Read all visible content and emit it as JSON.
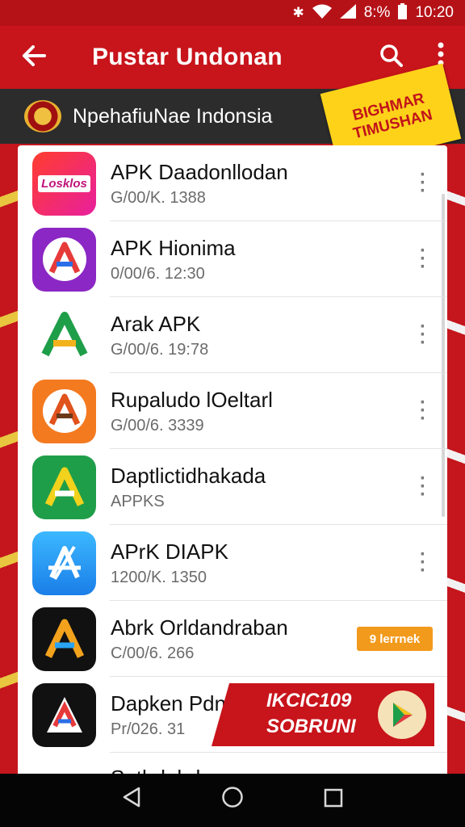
{
  "status": {
    "battery": "8:%",
    "time": "10:20"
  },
  "appbar": {
    "title": "Pustar Undonan"
  },
  "strip": {
    "text": "NpehafiuNae  Indonsia",
    "ribbon_line1": "BIGHMAR",
    "ribbon_line2": "TIMUSHAN"
  },
  "apps": [
    {
      "name": "APK Daadonllodan",
      "sub": "G/00/K. 1388",
      "icon": "lookos-icon",
      "icon_text": "Losklos",
      "color": "#e81f6a"
    },
    {
      "name": "APK Hionima",
      "sub": "0/00/6. 12:30",
      "icon": "a-logo-purple-icon",
      "color": "#8b27c4"
    },
    {
      "name": "Arak APK",
      "sub": "G/00/6. 19:78",
      "icon": "a-logo-green-icon",
      "color": "#ffffff"
    },
    {
      "name": "Rupaludo lOeltarl",
      "sub": "G/00/6. 3339",
      "icon": "a-logo-orange-icon",
      "color": "#f47a20"
    },
    {
      "name": "Daptlictidhakada",
      "sub": "APPKS",
      "icon": "a-logo-green-square-icon",
      "color": "#1f9e49"
    },
    {
      "name": "APrK DIAPK",
      "sub": "1200/K. 1350",
      "icon": "app-store-a-icon",
      "color": "#2aa3f2"
    },
    {
      "name": "Abrk Orldandraban",
      "sub": "C/00/6. 266",
      "icon": "a-logo-black-icon",
      "color": "#111111",
      "tag": "9 lerrnek"
    },
    {
      "name": "Dapken Pdn",
      "sub": "Pr/026. 31",
      "icon": "a-logo-black2-icon",
      "color": "#111111"
    },
    {
      "name": "Sathdahd",
      "sub": "",
      "icon": "partial-icon",
      "color": "#ffffff"
    }
  ],
  "promo": {
    "line1": "IKCIC109",
    "line2": "SOBRUNI"
  }
}
